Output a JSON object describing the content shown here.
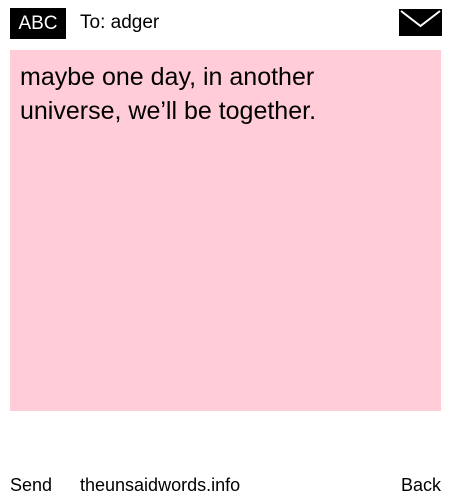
{
  "header": {
    "mode_label": "ABC",
    "recipient": "To: adger",
    "icon": "envelope-icon"
  },
  "message": {
    "text": "maybe one day, in another\nuniverse, we’ll be together.",
    "background_color": "#ffccd7"
  },
  "footer": {
    "send_label": "Send",
    "site_label": "theunsaidwords.info",
    "back_label": "Back"
  }
}
